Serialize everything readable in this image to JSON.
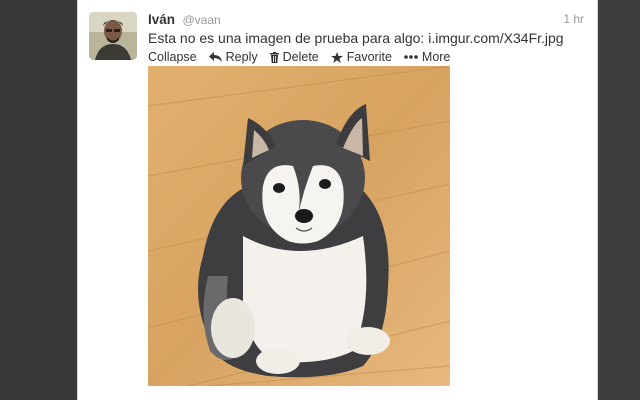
{
  "tweet": {
    "name": "Iván",
    "handle": "@vaan",
    "time": "1 hr",
    "text": "Esta no es una imagen de prueba para algo: ",
    "link": "i.imgur.com/X34Fr.jpg"
  },
  "actions": {
    "collapse": "Collapse",
    "reply": "Reply",
    "delete": "Delete",
    "favorite": "Favorite",
    "more": "More"
  },
  "icons": {
    "reply": "reply-arrow-icon",
    "delete": "trash-icon",
    "favorite": "star-icon",
    "more": "ellipsis-icon"
  },
  "colors": {
    "page_background": "#3a3a3a",
    "card_background": "#ffffff",
    "text": "#333333",
    "muted": "#999999"
  },
  "media": {
    "subject": "husky puppy photo"
  }
}
